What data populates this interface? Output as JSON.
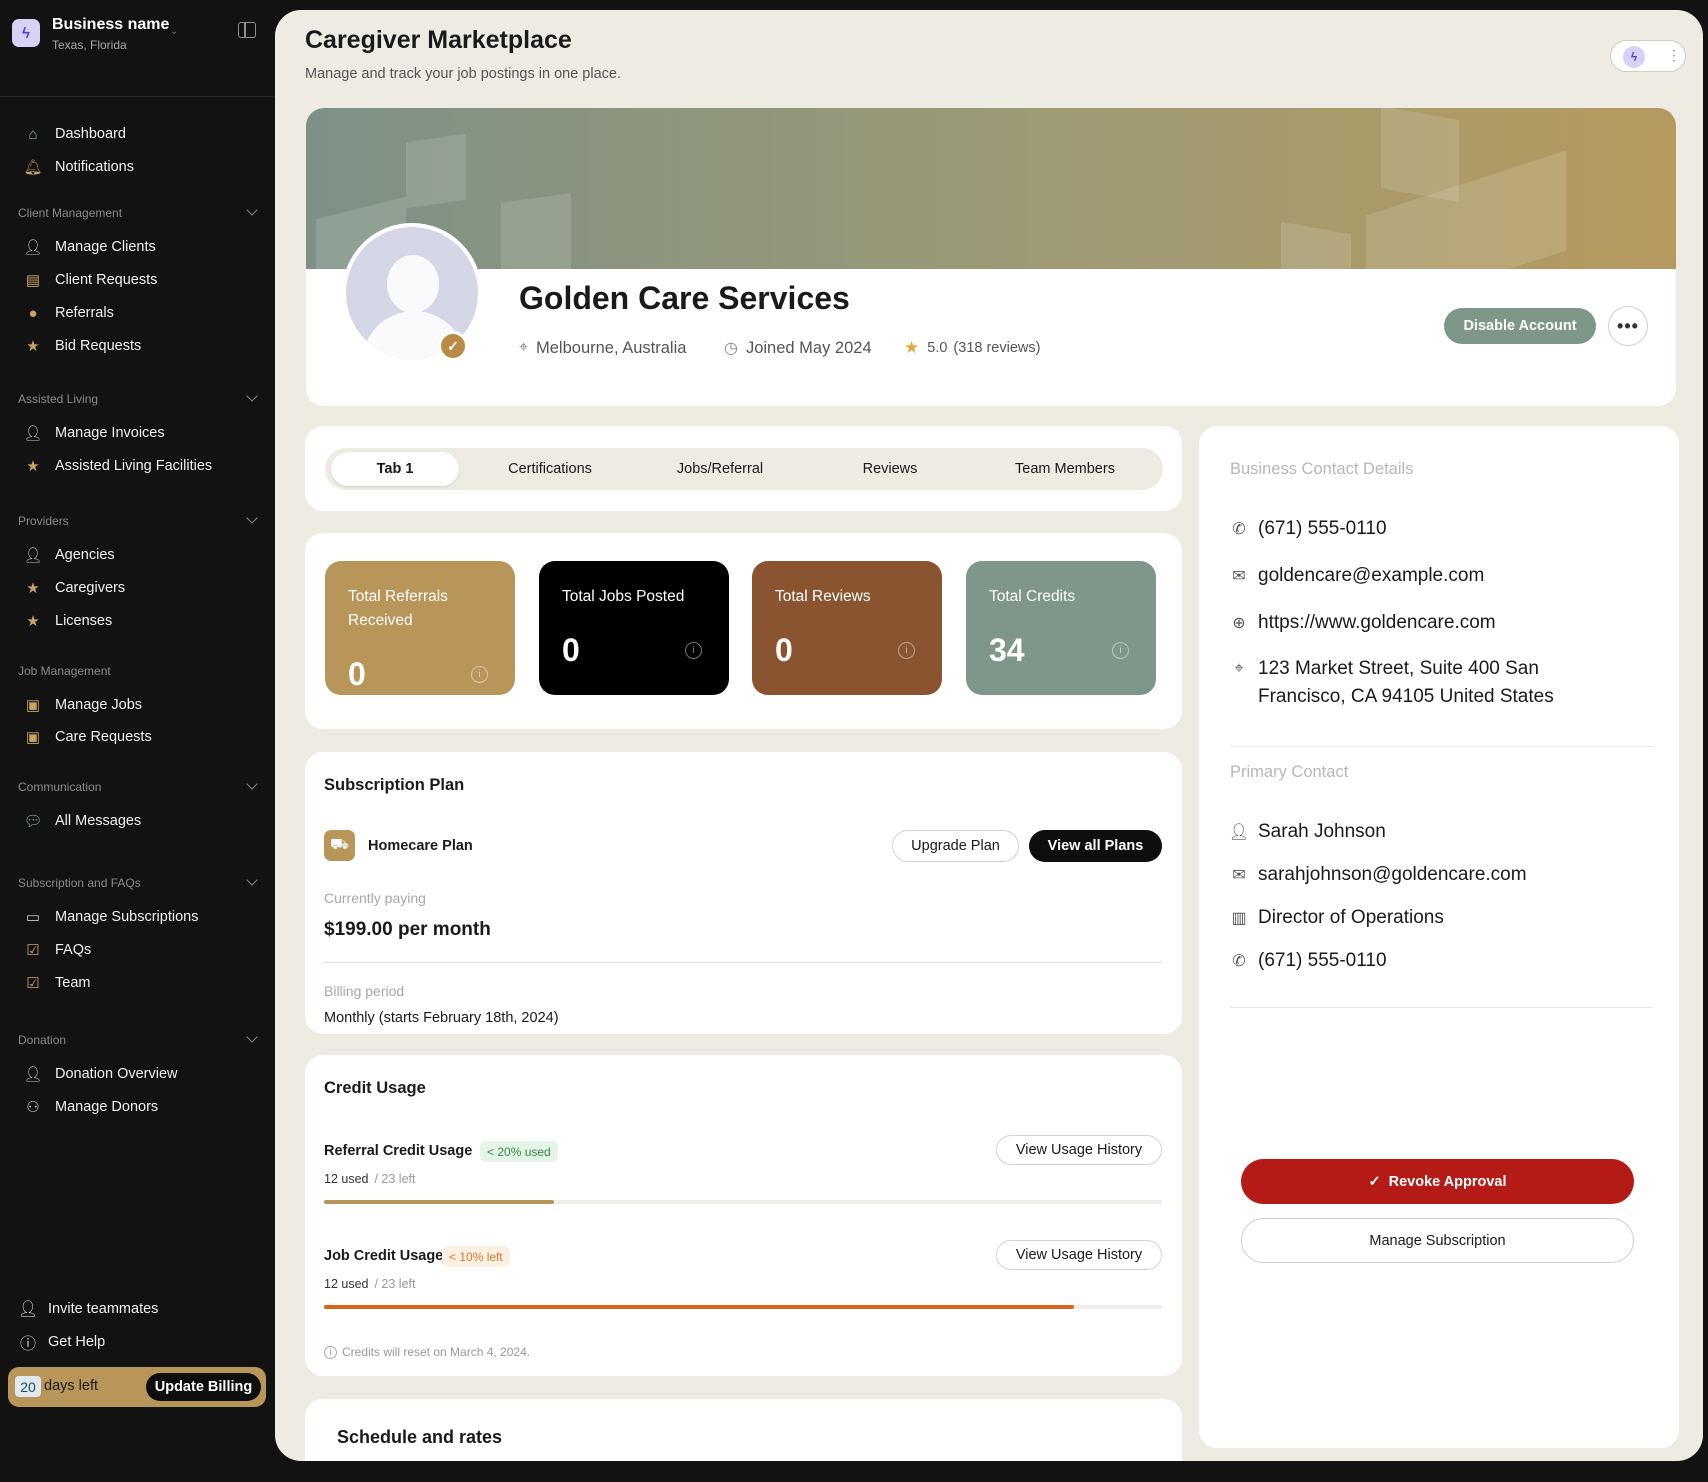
{
  "sidebar": {
    "business_name": "Business name",
    "business_location": "Texas, Florida",
    "top_items": [
      {
        "label": "Dashboard",
        "icon": "home-icon"
      },
      {
        "label": "Notifications",
        "icon": "bell-icon"
      }
    ],
    "sections": [
      {
        "label": "Client Management",
        "items": [
          {
            "label": "Manage Clients",
            "icon": "users-icon"
          },
          {
            "label": "Client Requests",
            "icon": "document-icon"
          },
          {
            "label": "Referrals",
            "icon": "user-icon"
          },
          {
            "label": "Bid Requests",
            "icon": "star-icon"
          }
        ]
      },
      {
        "label": "Assisted Living",
        "items": [
          {
            "label": "Manage Invoices",
            "icon": "users-icon"
          },
          {
            "label": "Assisted Living Facilities",
            "icon": "star-icon"
          }
        ]
      },
      {
        "label": "Providers",
        "items": [
          {
            "label": "Agencies",
            "icon": "users-icon"
          },
          {
            "label": "Caregivers",
            "icon": "star-icon"
          },
          {
            "label": "Licenses",
            "icon": "star-icon"
          }
        ]
      },
      {
        "label": "Job Management",
        "items": [
          {
            "label": "Manage Jobs",
            "icon": "briefcase-icon"
          },
          {
            "label": "Care Requests",
            "icon": "briefcase-icon"
          }
        ]
      },
      {
        "label": "Communication",
        "items": [
          {
            "label": "All Messages",
            "icon": "chat-icon"
          }
        ]
      },
      {
        "label": "Subscription and FAQs",
        "items": [
          {
            "label": "Manage Subscriptions",
            "icon": "card-icon"
          },
          {
            "label": "FAQs",
            "icon": "checklist-icon"
          },
          {
            "label": "Team",
            "icon": "checklist-icon"
          }
        ]
      },
      {
        "label": "Donation",
        "items": [
          {
            "label": "Donation Overview",
            "icon": "user-icon"
          },
          {
            "label": "Manage Donors",
            "icon": "group-icon"
          }
        ]
      }
    ],
    "footer": {
      "invite": "Invite teammates",
      "help": "Get Help",
      "days_count": "20",
      "days_text": "days left",
      "update_billing": "Update Billing"
    }
  },
  "header": {
    "title": "Caregiver Marketplace",
    "subtitle": "Manage and track your job postings in one place."
  },
  "profile": {
    "name": "Golden Care Services",
    "location": "Melbourne, Australia",
    "joined": "Joined May 2024",
    "rating": "5.0",
    "reviews": "(318 reviews)",
    "disable_button": "Disable Account"
  },
  "tabs": [
    "Tab 1",
    "Certifications",
    "Jobs/Referral",
    "Reviews",
    "Team Members"
  ],
  "stats": [
    {
      "label": "Total Referrals Received",
      "value": "0",
      "color": "#b8965a"
    },
    {
      "label": "Total Jobs Posted",
      "value": "0",
      "color": "#000000"
    },
    {
      "label": "Total Reviews",
      "value": "0",
      "color": "#8a5430"
    },
    {
      "label": "Total Credits",
      "value": "34",
      "color": "#7f9788"
    }
  ],
  "subscription": {
    "title": "Subscription Plan",
    "plan_name": "Homecare Plan",
    "upgrade_button": "Upgrade Plan",
    "view_plans_button": "View all Plans",
    "paying_label": "Currently paying",
    "paying_value": "$199.00 per month",
    "billing_label": "Billing period",
    "billing_value": "Monthly (starts February 18th, 2024)"
  },
  "credit_usage": {
    "title": "Credit Usage",
    "items": [
      {
        "name": "Referral Credit Usage",
        "badge": "< 20% used",
        "used": "12 used",
        "left": "/ 23 left",
        "fraction": 0.275,
        "color": "#b8965a",
        "button": "View Usage History"
      },
      {
        "name": "Job Credit Usage",
        "badge": "< 10% left",
        "used": "12 used",
        "left": "/ 23 left",
        "fraction": 0.895,
        "color": "#d8651c",
        "button": "View Usage History"
      }
    ],
    "note": "Credits will reset on March 4, 2024."
  },
  "schedule": {
    "title": "Schedule and rates"
  },
  "contact": {
    "business_heading": "Business Contact Details",
    "phone": "(671) 555-0110",
    "email": "goldencare@example.com",
    "website": "https://www.goldencare.com",
    "address": "123 Market Street, Suite 400 San Francisco, CA 94105 United States",
    "primary_heading": "Primary Contact",
    "person_name": "Sarah Johnson",
    "person_email": "sarahjohnson@goldencare.com",
    "person_role": "Director of Operations",
    "person_phone": "(671) 555-0110",
    "revoke_button": "Revoke Approval",
    "manage_button": "Manage Subscription"
  }
}
